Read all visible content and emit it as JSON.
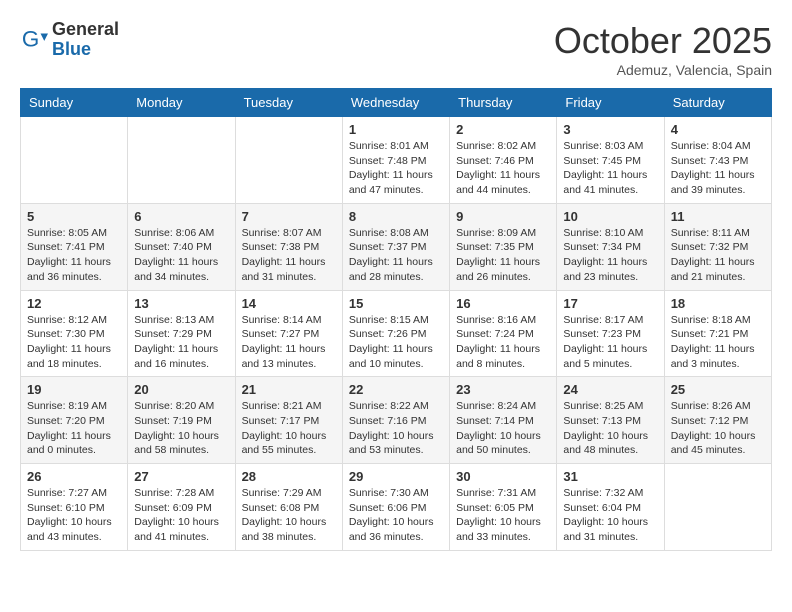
{
  "header": {
    "logo_general": "General",
    "logo_blue": "Blue",
    "month_title": "October 2025",
    "location": "Ademuz, Valencia, Spain"
  },
  "days_of_week": [
    "Sunday",
    "Monday",
    "Tuesday",
    "Wednesday",
    "Thursday",
    "Friday",
    "Saturday"
  ],
  "weeks": [
    [
      {
        "day": "",
        "info": ""
      },
      {
        "day": "",
        "info": ""
      },
      {
        "day": "",
        "info": ""
      },
      {
        "day": "1",
        "info": "Sunrise: 8:01 AM\nSunset: 7:48 PM\nDaylight: 11 hours\nand 47 minutes."
      },
      {
        "day": "2",
        "info": "Sunrise: 8:02 AM\nSunset: 7:46 PM\nDaylight: 11 hours\nand 44 minutes."
      },
      {
        "day": "3",
        "info": "Sunrise: 8:03 AM\nSunset: 7:45 PM\nDaylight: 11 hours\nand 41 minutes."
      },
      {
        "day": "4",
        "info": "Sunrise: 8:04 AM\nSunset: 7:43 PM\nDaylight: 11 hours\nand 39 minutes."
      }
    ],
    [
      {
        "day": "5",
        "info": "Sunrise: 8:05 AM\nSunset: 7:41 PM\nDaylight: 11 hours\nand 36 minutes."
      },
      {
        "day": "6",
        "info": "Sunrise: 8:06 AM\nSunset: 7:40 PM\nDaylight: 11 hours\nand 34 minutes."
      },
      {
        "day": "7",
        "info": "Sunrise: 8:07 AM\nSunset: 7:38 PM\nDaylight: 11 hours\nand 31 minutes."
      },
      {
        "day": "8",
        "info": "Sunrise: 8:08 AM\nSunset: 7:37 PM\nDaylight: 11 hours\nand 28 minutes."
      },
      {
        "day": "9",
        "info": "Sunrise: 8:09 AM\nSunset: 7:35 PM\nDaylight: 11 hours\nand 26 minutes."
      },
      {
        "day": "10",
        "info": "Sunrise: 8:10 AM\nSunset: 7:34 PM\nDaylight: 11 hours\nand 23 minutes."
      },
      {
        "day": "11",
        "info": "Sunrise: 8:11 AM\nSunset: 7:32 PM\nDaylight: 11 hours\nand 21 minutes."
      }
    ],
    [
      {
        "day": "12",
        "info": "Sunrise: 8:12 AM\nSunset: 7:30 PM\nDaylight: 11 hours\nand 18 minutes."
      },
      {
        "day": "13",
        "info": "Sunrise: 8:13 AM\nSunset: 7:29 PM\nDaylight: 11 hours\nand 16 minutes."
      },
      {
        "day": "14",
        "info": "Sunrise: 8:14 AM\nSunset: 7:27 PM\nDaylight: 11 hours\nand 13 minutes."
      },
      {
        "day": "15",
        "info": "Sunrise: 8:15 AM\nSunset: 7:26 PM\nDaylight: 11 hours\nand 10 minutes."
      },
      {
        "day": "16",
        "info": "Sunrise: 8:16 AM\nSunset: 7:24 PM\nDaylight: 11 hours\nand 8 minutes."
      },
      {
        "day": "17",
        "info": "Sunrise: 8:17 AM\nSunset: 7:23 PM\nDaylight: 11 hours\nand 5 minutes."
      },
      {
        "day": "18",
        "info": "Sunrise: 8:18 AM\nSunset: 7:21 PM\nDaylight: 11 hours\nand 3 minutes."
      }
    ],
    [
      {
        "day": "19",
        "info": "Sunrise: 8:19 AM\nSunset: 7:20 PM\nDaylight: 11 hours\nand 0 minutes."
      },
      {
        "day": "20",
        "info": "Sunrise: 8:20 AM\nSunset: 7:19 PM\nDaylight: 10 hours\nand 58 minutes."
      },
      {
        "day": "21",
        "info": "Sunrise: 8:21 AM\nSunset: 7:17 PM\nDaylight: 10 hours\nand 55 minutes."
      },
      {
        "day": "22",
        "info": "Sunrise: 8:22 AM\nSunset: 7:16 PM\nDaylight: 10 hours\nand 53 minutes."
      },
      {
        "day": "23",
        "info": "Sunrise: 8:24 AM\nSunset: 7:14 PM\nDaylight: 10 hours\nand 50 minutes."
      },
      {
        "day": "24",
        "info": "Sunrise: 8:25 AM\nSunset: 7:13 PM\nDaylight: 10 hours\nand 48 minutes."
      },
      {
        "day": "25",
        "info": "Sunrise: 8:26 AM\nSunset: 7:12 PM\nDaylight: 10 hours\nand 45 minutes."
      }
    ],
    [
      {
        "day": "26",
        "info": "Sunrise: 7:27 AM\nSunset: 6:10 PM\nDaylight: 10 hours\nand 43 minutes."
      },
      {
        "day": "27",
        "info": "Sunrise: 7:28 AM\nSunset: 6:09 PM\nDaylight: 10 hours\nand 41 minutes."
      },
      {
        "day": "28",
        "info": "Sunrise: 7:29 AM\nSunset: 6:08 PM\nDaylight: 10 hours\nand 38 minutes."
      },
      {
        "day": "29",
        "info": "Sunrise: 7:30 AM\nSunset: 6:06 PM\nDaylight: 10 hours\nand 36 minutes."
      },
      {
        "day": "30",
        "info": "Sunrise: 7:31 AM\nSunset: 6:05 PM\nDaylight: 10 hours\nand 33 minutes."
      },
      {
        "day": "31",
        "info": "Sunrise: 7:32 AM\nSunset: 6:04 PM\nDaylight: 10 hours\nand 31 minutes."
      },
      {
        "day": "",
        "info": ""
      }
    ]
  ]
}
